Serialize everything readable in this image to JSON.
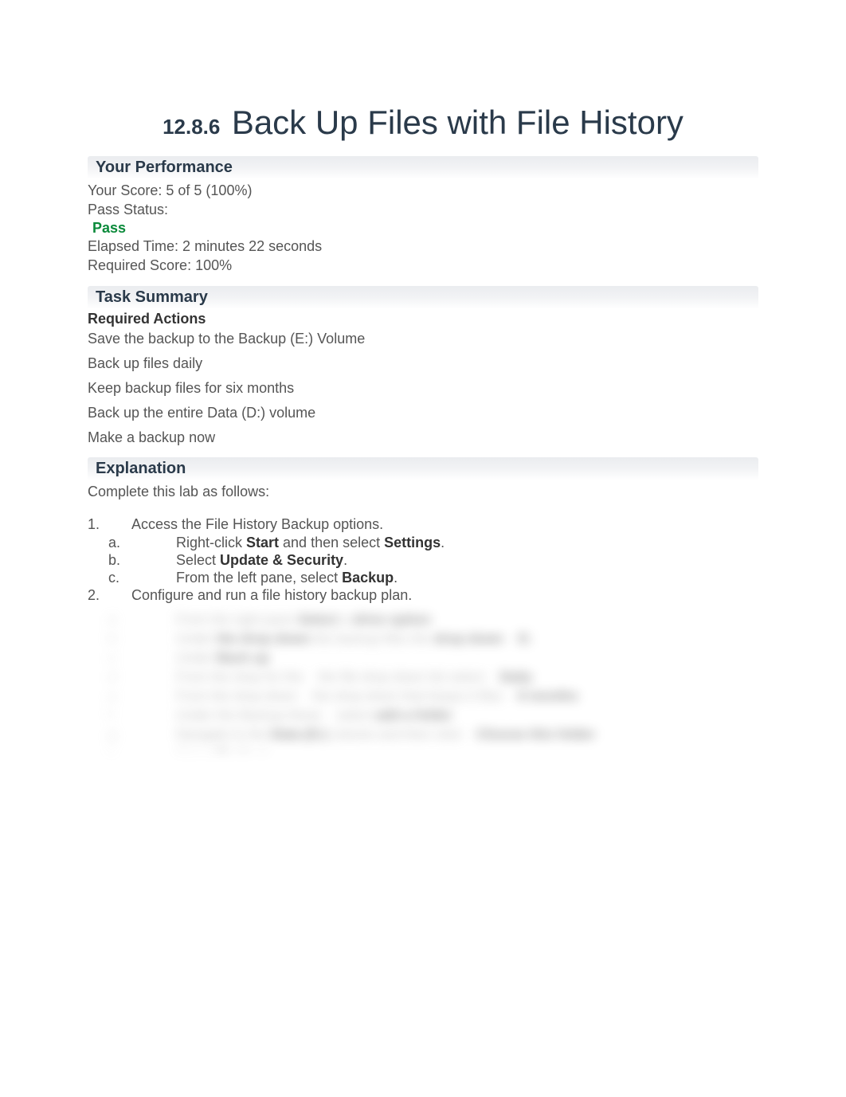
{
  "title": {
    "number": "12.8.6",
    "text": "Back Up Files with File History"
  },
  "performance": {
    "header": "Your Performance",
    "score_label": "Your Score: 5 of 5 (100%)",
    "pass_label": "Pass Status:",
    "pass_value": "Pass",
    "elapsed": "Elapsed Time: 2 minutes 22 seconds",
    "required": "Required Score: 100%"
  },
  "task_summary": {
    "header": "Task Summary",
    "required_header": "Required Actions",
    "actions": [
      "Save the backup to the Backup (E:) Volume",
      "Back up files daily",
      "Keep backup files for six months",
      "Back up the entire Data (D:) volume",
      "Make a backup now"
    ]
  },
  "explanation": {
    "header": "Explanation",
    "intro": "Complete this lab as follows:",
    "step1_num": "1.",
    "step1_text": "Access the File History Backup options.",
    "step1a_letter": "a.",
    "step1a_pre": "Right-click ",
    "step1a_b1": "Start",
    "step1a_mid": " and then select ",
    "step1a_b2": "Settings",
    "step1a_post": ".",
    "step1b_letter": "b.",
    "step1b_pre": "Select ",
    "step1b_b1": "Update & Security",
    "step1b_post": ".",
    "step1c_letter": "c.",
    "step1c_pre": "From the left pane, select ",
    "step1c_b1": "Backup",
    "step1c_post": ".",
    "step2_num": "2.",
    "step2_text": "Configure and run a file history backup plan."
  }
}
